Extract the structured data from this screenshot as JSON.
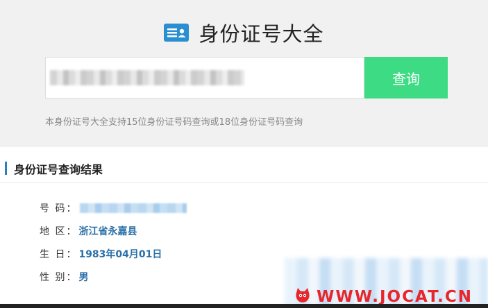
{
  "header": {
    "title": "身份证号大全",
    "icon": "id-card-icon"
  },
  "search": {
    "value": "",
    "placeholder": "",
    "button_label": "查询",
    "button_color": "#3ddc84"
  },
  "hint": "本身份证号大全支持15位身份证号码查询或18位身份证号码查询",
  "result": {
    "title": "身份证号查询结果",
    "rows": [
      {
        "label": "号 码：",
        "value": ""
      },
      {
        "label": "地 区：",
        "value": "浙江省永嘉县"
      },
      {
        "label": "生 日：",
        "value": "1983年04月01日"
      },
      {
        "label": "性 别：",
        "value": "男"
      }
    ]
  },
  "watermark": {
    "text": "WWW.JOCAT.CN",
    "icon": "cat-logo-icon",
    "color": "#e8262c"
  }
}
